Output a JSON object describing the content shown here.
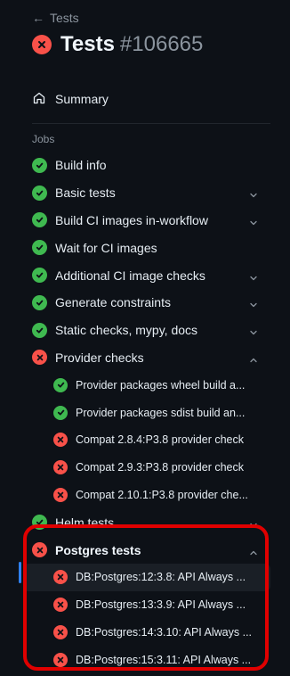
{
  "header": {
    "back_label": "Tests",
    "title": "Tests",
    "run_number": "#106665",
    "status": "failure"
  },
  "nav": {
    "summary_label": "Summary"
  },
  "jobs_heading": "Jobs",
  "jobs": [
    {
      "label": "Build info",
      "status": "success",
      "chevron": "none"
    },
    {
      "label": "Basic tests",
      "status": "success",
      "chevron": "down"
    },
    {
      "label": "Build CI images in-workflow",
      "status": "success",
      "chevron": "down"
    },
    {
      "label": "Wait for CI images",
      "status": "success",
      "chevron": "none"
    },
    {
      "label": "Additional CI image checks",
      "status": "success",
      "chevron": "down"
    },
    {
      "label": "Generate constraints",
      "status": "success",
      "chevron": "down"
    },
    {
      "label": "Static checks, mypy, docs",
      "status": "success",
      "chevron": "down"
    },
    {
      "label": "Provider checks",
      "status": "failure",
      "chevron": "up"
    },
    {
      "label": "Provider packages wheel build a...",
      "status": "success",
      "sub": true
    },
    {
      "label": "Provider packages sdist build an...",
      "status": "success",
      "sub": true
    },
    {
      "label": "Compat 2.8.4:P3.8 provider check",
      "status": "failure",
      "sub": true
    },
    {
      "label": "Compat 2.9.3:P3.8 provider check",
      "status": "failure",
      "sub": true
    },
    {
      "label": "Compat 2.10.1:P3.8 provider che...",
      "status": "failure",
      "sub": true
    },
    {
      "label": "Helm tests",
      "status": "success",
      "chevron": "down"
    },
    {
      "label": "Postgres tests",
      "status": "failure",
      "chevron": "up",
      "bold": true
    },
    {
      "label": "DB:Postgres:12:3.8: API Always ...",
      "status": "failure",
      "sub": true,
      "active": true
    },
    {
      "label": "DB:Postgres:13:3.9: API Always ...",
      "status": "failure",
      "sub": true
    },
    {
      "label": "DB:Postgres:14:3.10: API Always ...",
      "status": "failure",
      "sub": true
    },
    {
      "label": "DB:Postgres:15:3.11: API Always ...",
      "status": "failure",
      "sub": true
    }
  ],
  "colors": {
    "success": "#3fb950",
    "failure": "#f85149",
    "active_bar": "#2f81f7",
    "highlight": "#e00000"
  },
  "icons": {
    "back": "arrow-left-icon",
    "summary": "home-icon",
    "success": "check-circle-icon",
    "failure": "x-circle-icon",
    "chevron_down": "chevron-down-icon",
    "chevron_up": "chevron-up-icon"
  }
}
